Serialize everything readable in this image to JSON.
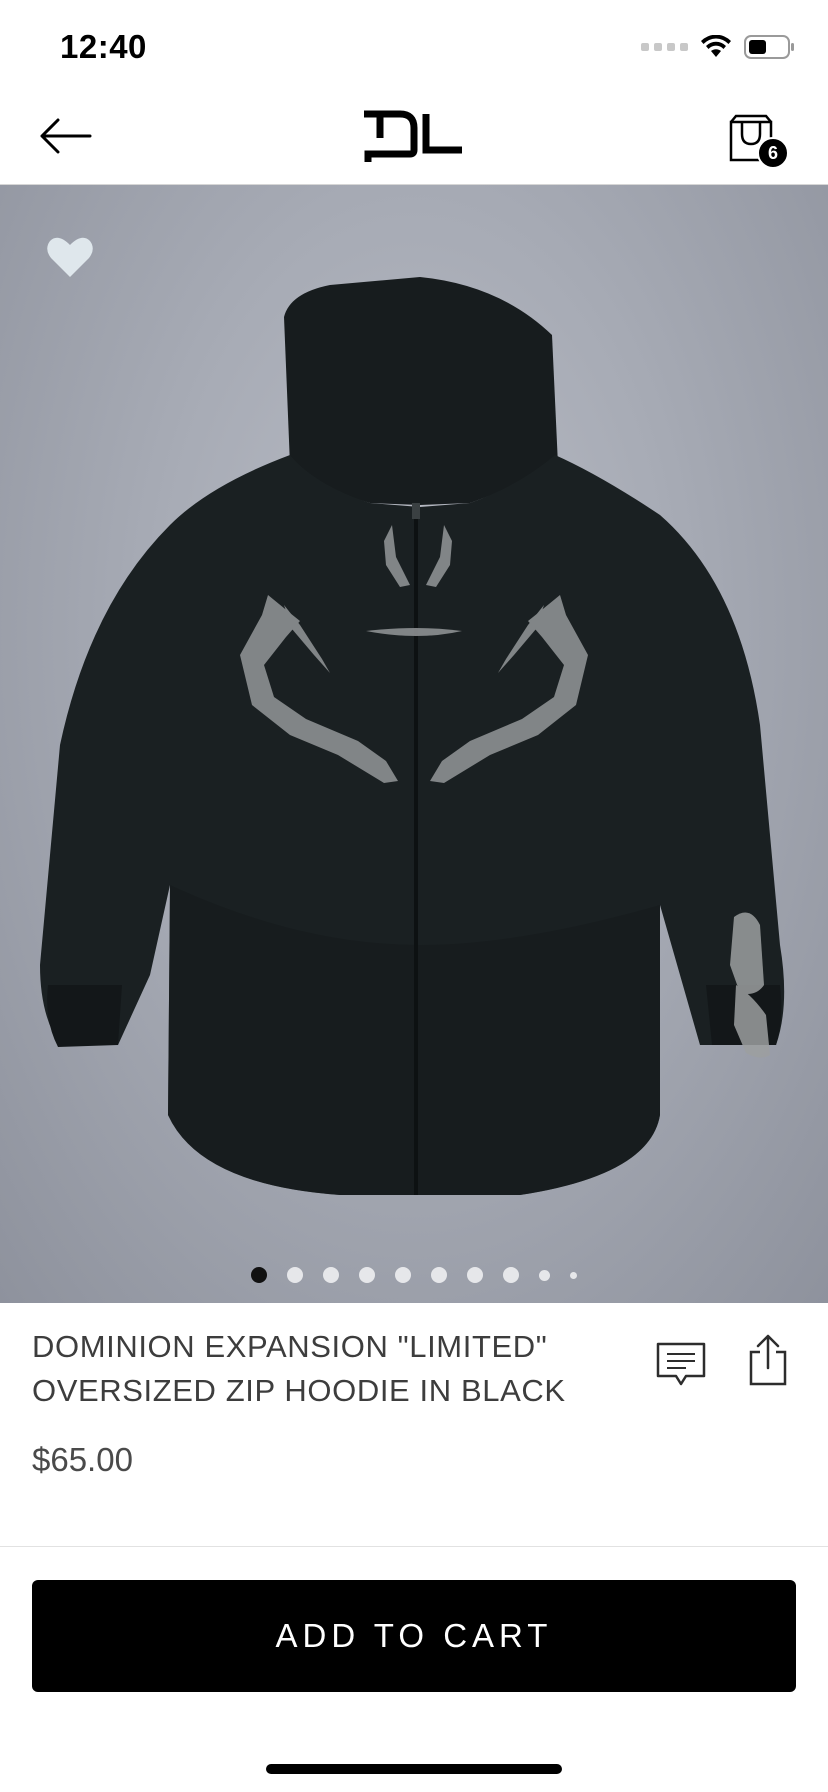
{
  "status_bar": {
    "time": "12:40",
    "icons": [
      "cellular-signal-icon",
      "wifi-icon",
      "battery-icon"
    ]
  },
  "nav": {
    "back_icon": "arrow-left-icon",
    "logo": "DL",
    "cart_icon": "shopping-bag-icon",
    "cart_count": "6"
  },
  "hero": {
    "favorite_icon": "heart-icon",
    "image_subject": "black zip hoodie",
    "page_count": 10,
    "active_page": 1
  },
  "product": {
    "title": "DOMINION EXPANSION \"LIMITED\" OVERSIZED ZIP HOODIE IN BLACK",
    "price": "$65.00",
    "actions": [
      "chat-icon",
      "share-icon"
    ]
  },
  "cta": {
    "add_to_cart_label": "ADD TO CART"
  },
  "colors": {
    "primary": "#000000",
    "text": "#3d3d3d",
    "heart": "#dfe7ec",
    "hero_bg": "#a7abb5"
  }
}
